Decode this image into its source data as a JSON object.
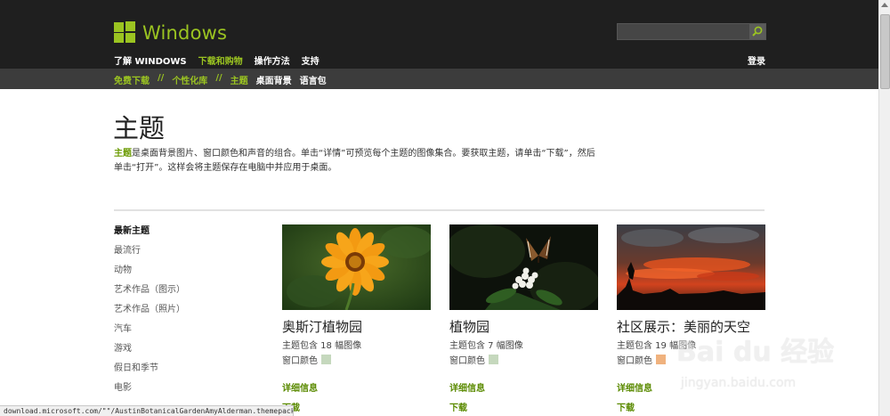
{
  "header": {
    "logo_text": "Windows",
    "search_placeholder": "",
    "nav": [
      "了解 WINDOWS",
      "下载和购物",
      "操作方法",
      "支持"
    ],
    "nav_active_index": 1,
    "login": "登录"
  },
  "subnav": {
    "items": [
      "免费下载",
      "//",
      "个性化库",
      "//",
      "主题",
      "桌面背景",
      "语言包"
    ]
  },
  "page": {
    "title": "主题",
    "intro_highlight": "主题",
    "intro_line1": "是桌面背景图片、窗口颜色和声音的组合。单击“详情”可预览每个主题的图像集合。要获取主题，请单击“下载”，然后",
    "intro_line2": "单击“打开”。这样会将主题保存在电脑中并应用于桌面。"
  },
  "categories": [
    "最新主题",
    "最流行",
    "动物",
    "艺术作品（图示）",
    "艺术作品（照片）",
    "汽车",
    "游戏",
    "假日和季节",
    "电影"
  ],
  "cards": [
    {
      "title": "奥斯汀植物园",
      "count": "主题包含 18 幅图像",
      "color_label": "窗口颜色",
      "color": "#c5d8bd",
      "details": "详细信息",
      "download": "下载"
    },
    {
      "title": "植物园",
      "count": "主题包含 7 幅图像",
      "color_label": "窗口颜色",
      "color": "#c5d8bd",
      "details": "详细信息",
      "download": "下载"
    },
    {
      "title": "社区展示：美丽的天空",
      "count": "主题包含 19 幅图像",
      "color_label": "窗口颜色",
      "color": "#f0b27e",
      "details": "详细信息",
      "download": "下载"
    }
  ],
  "status_bar": "download.microsoft.com/\"\"/AustinBotanicalGardenAmyAlderman.themepack",
  "watermark": {
    "logo": "Bai du 经验",
    "url": "jingyan.baidu.com"
  },
  "colors": {
    "brand_green": "#9bc421",
    "link_green": "#5a8a00",
    "header_bg": "#1f1f1f",
    "subnav_bg": "#3c3c3c"
  }
}
